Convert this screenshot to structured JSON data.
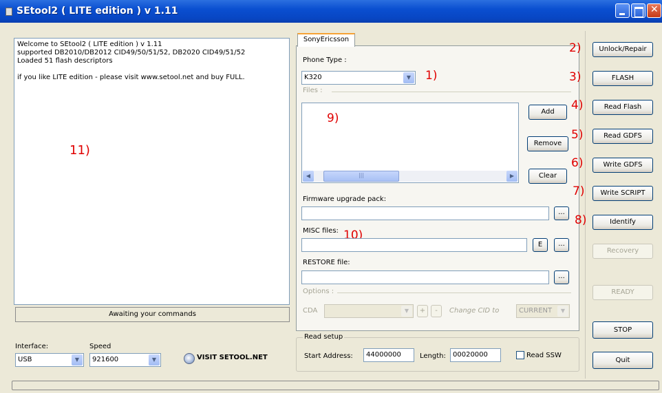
{
  "window": {
    "title": "SEtool2 ( LITE edition ) v 1.11"
  },
  "log": {
    "lines": "Welcome to SEtool2 ( LITE edition ) v 1.11\nsupported DB2010/DB2012 CID49/50/51/52, DB2020 CID49/51/52\nLoaded 51 flash descriptors\n\nif you like LITE edition - please visit www.setool.net and buy FULL."
  },
  "status": "Awaiting your commands",
  "interface": {
    "label": "Interface:",
    "value": "USB"
  },
  "speed": {
    "label": "Speed",
    "value": "921600"
  },
  "visit": {
    "label": "VISIT SETOOL.NET"
  },
  "tab": {
    "label": "SonyEricsson"
  },
  "phone_type": {
    "label": "Phone Type :",
    "value": "K320"
  },
  "files": {
    "label": "Files :",
    "add": "Add",
    "remove": "Remove",
    "clear": "Clear"
  },
  "firmware": {
    "label": "Firmware upgrade pack:",
    "browse": "..."
  },
  "misc": {
    "label": "MISC files:",
    "e_button": "E",
    "browse": "..."
  },
  "restore": {
    "label": "RESTORE file:",
    "browse": "..."
  },
  "options": {
    "label": "Options :",
    "cda_label": "CDA",
    "plus": "+",
    "minus": "-",
    "change_cid_label": "Change CID to",
    "cid_value": "CURRENT"
  },
  "read_setup": {
    "label": "Read setup",
    "start_label": "Start Address:",
    "start_value": "44000000",
    "length_label": "Length:",
    "length_value": "00020000",
    "ssw_label": "Read SSW"
  },
  "actions": {
    "unlock": "Unlock/Repair",
    "flash": "FLASH",
    "read_flash": "Read Flash",
    "read_gdfs": "Read GDFS",
    "write_gdfs": "Write GDFS",
    "write_script": "Write SCRIPT",
    "identify": "Identify",
    "recovery": "Recovery",
    "ready": "READY",
    "stop": "STOP",
    "quit": "Quit"
  },
  "annotations": {
    "n1": "1)",
    "n2": "2)",
    "n3": "3)",
    "n4": "4)",
    "n5": "5)",
    "n6": "6)",
    "n7": "7)",
    "n8": "8)",
    "n9": "9)",
    "n10": "10)",
    "n11": "11)"
  },
  "colors": {
    "titlebar": "#0a4fd0",
    "annotation": "#e00000",
    "window_bg": "#ece9d8"
  }
}
